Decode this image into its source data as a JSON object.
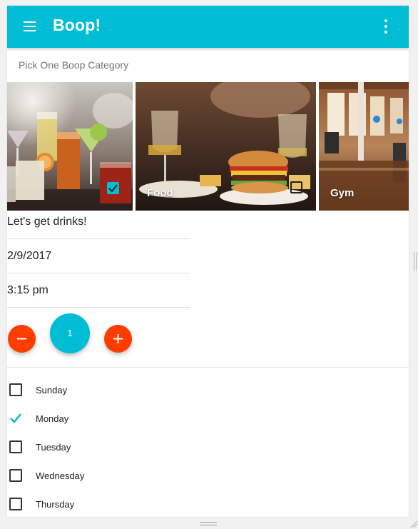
{
  "toolbar": {
    "title": "Boop!",
    "menu_icon": "menu-icon",
    "more_icon": "more-vert-icon",
    "color": "#00bcd4"
  },
  "category": {
    "subheader": "Pick One Boop Category",
    "tiles": [
      {
        "name": "drinks",
        "label": "",
        "checked": true
      },
      {
        "name": "food",
        "label": "Food",
        "checked": false
      },
      {
        "name": "gym",
        "label": "Gym",
        "checked": false
      }
    ]
  },
  "form": {
    "message": "Let's get drinks!",
    "date": "2/9/2017",
    "time": "3:15 pm"
  },
  "counter": {
    "value": "1",
    "decrement_icon": "minus-icon",
    "increment_icon": "plus-icon",
    "accent": "#ff3d00"
  },
  "days": [
    {
      "label": "Sunday",
      "checked": false
    },
    {
      "label": "Monday",
      "checked": true
    },
    {
      "label": "Tuesday",
      "checked": false
    },
    {
      "label": "Wednesday",
      "checked": false
    },
    {
      "label": "Thursday",
      "checked": false
    }
  ]
}
